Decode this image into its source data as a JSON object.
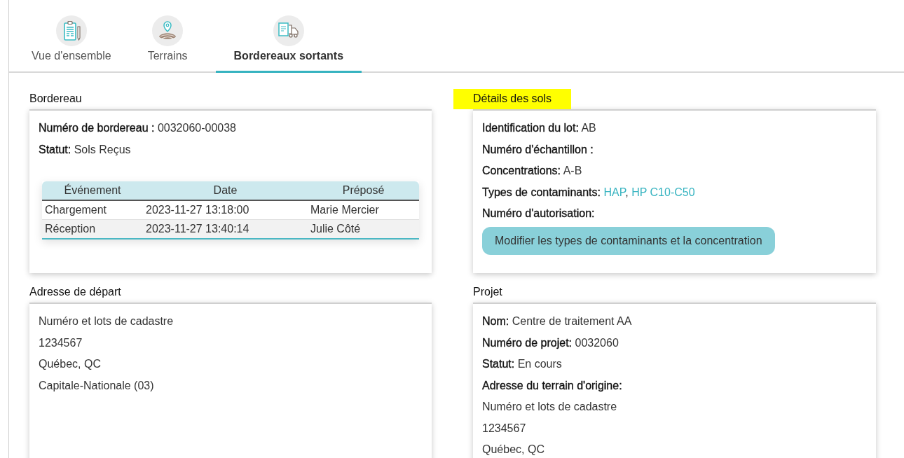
{
  "tabs": [
    {
      "label": "Vue d'ensemble",
      "kind": "clipboard",
      "selected": false
    },
    {
      "label": "Terrains",
      "kind": "field",
      "selected": false
    },
    {
      "label": "Bordereaux sortants",
      "kind": "truck",
      "selected": true
    }
  ],
  "sections": [
    {
      "title": "Bordereau",
      "highlighted": false,
      "fields": [
        {
          "label": "Numéro de bordereau :",
          "value": "0032060-00038"
        },
        {
          "label": "Statut:",
          "value": "Sols Reçus"
        }
      ],
      "table": {
        "columns": [
          "Événement",
          "Date",
          "Préposé"
        ],
        "rows": [
          [
            "Chargement",
            "2023-11-27 13:18:00",
            "Marie Mercier"
          ],
          [
            "Réception",
            "2023-11-27 13:40:14",
            "Julie Côté"
          ]
        ]
      }
    },
    {
      "title": "Détails des sols",
      "highlighted": true,
      "fields": [
        {
          "label": "Identification du lot:",
          "value": "AB"
        },
        {
          "label": "Numéro d'échantillon :"
        },
        {
          "label": "Concentrations:",
          "value": "A-B"
        },
        {
          "label": "Types de contaminants:",
          "links": [
            "HAP",
            "HP C10-C50"
          ],
          "separator": ", "
        },
        {
          "label": "Numéro d'autorisation:"
        }
      ],
      "button": "Modifier les types de contaminants et la concentration"
    },
    {
      "title": "Adresse de départ",
      "highlighted": false,
      "fields": [
        {
          "value": "Numéro et lots de cadastre"
        },
        {
          "value": "1234567"
        },
        {
          "value": "Québec, QC"
        },
        {
          "value": "Capitale-Nationale (03)"
        }
      ]
    },
    {
      "title": "Projet",
      "highlighted": false,
      "fields": [
        {
          "label": "Nom:",
          "value": "Centre de traitement AA"
        },
        {
          "label": "Numéro de projet:",
          "value": "0032060"
        },
        {
          "label": "Statut:",
          "value": "En cours"
        },
        {
          "label": "Adresse du terrain d'origine:"
        },
        {
          "value": "Numéro et lots de cadastre"
        },
        {
          "value": "1234567"
        },
        {
          "value": "Québec, QC"
        }
      ]
    }
  ]
}
